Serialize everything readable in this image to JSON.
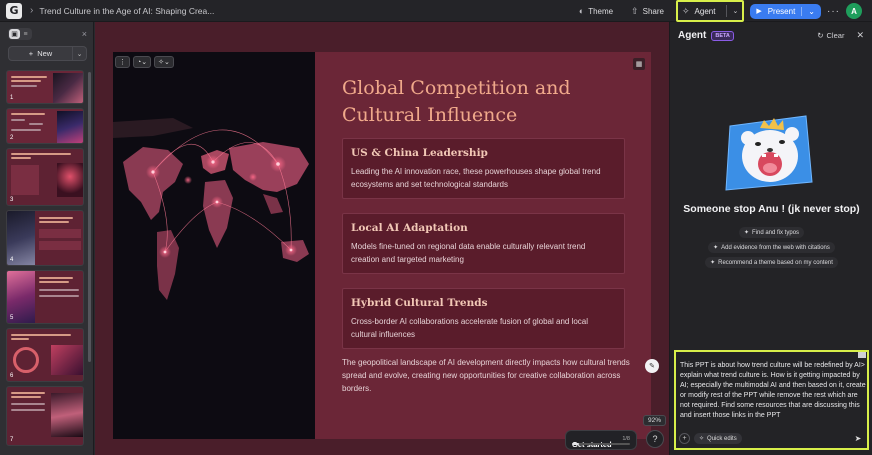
{
  "topbar": {
    "logo_letter": "G",
    "breadcrumb_sep": "›",
    "doc_title": "Trend Culture in the Age of AI: Shaping Crea...",
    "theme_label": "Theme",
    "share_label": "Share",
    "agent_label": "Agent",
    "present_label": "Present",
    "avatar_initial": "A"
  },
  "sidebar": {
    "new_label": "New",
    "slides": [
      {
        "num": "1"
      },
      {
        "num": "2"
      },
      {
        "num": "3"
      },
      {
        "num": "4"
      },
      {
        "num": "5"
      },
      {
        "num": "6"
      },
      {
        "num": "7"
      }
    ]
  },
  "slide": {
    "title": "Global Competition and Cultural Influence",
    "cards": [
      {
        "heading": "US & China Leadership",
        "body": "Leading the AI innovation race, these powerhouses shape global trend ecosystems and set technological standards"
      },
      {
        "heading": "Local AI Adaptation",
        "body": "Models fine-tuned on regional data enable culturally relevant trend creation and targeted marketing"
      },
      {
        "heading": "Hybrid Cultural Trends",
        "body": "Cross-border AI collaborations accelerate fusion of global and local cultural influences"
      }
    ],
    "footer": "The geopolitical landscape of AI development directly impacts how cultural trends spread and evolve, creating new opportunities for creative collaboration across borders."
  },
  "canvas": {
    "zoom": "92%",
    "get_started": "Get started",
    "get_started_count": "1/8",
    "get_started_progress": 0.125,
    "help": "?"
  },
  "agent": {
    "title": "Agent",
    "beta": "BETA",
    "clear": "Clear",
    "heading": "Someone stop Anu ! (jk never stop)",
    "suggestions": [
      "Find and fix typos",
      "Add evidence from the web with citations",
      "Recommend a theme based on my content"
    ],
    "prompt": "This PPT is about how trend culture will be redefined by AI> explain what trend culture is. How is it getting impacted by AI; especially the multimodal AI and then based on it, create or modify rest of the PPT while remove the rest which are not required. Find some resources that are discussing this and insert those links in the PPT",
    "quick_edits": "Quick edits"
  },
  "colors": {
    "accent_highlight": "#d8ef4a",
    "present_blue": "#3a7cf0",
    "slide_bg": "#6b2637",
    "title_peach": "#f0a98b"
  }
}
